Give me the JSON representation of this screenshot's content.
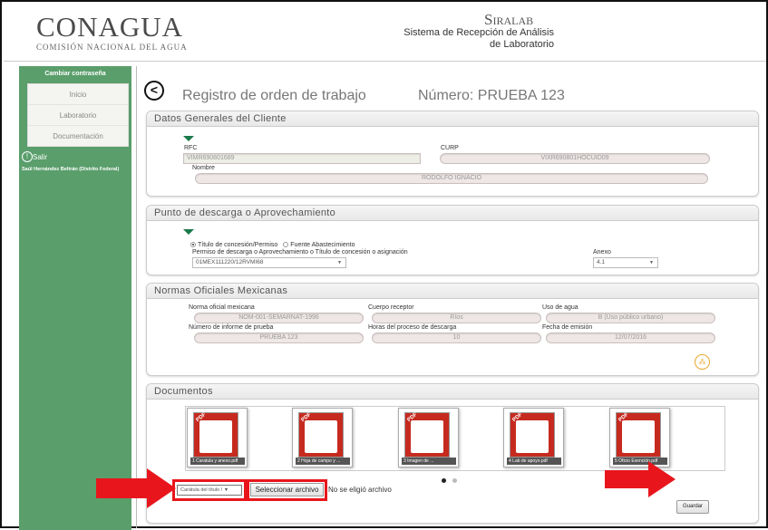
{
  "header": {
    "logo_title": "CONAGUA",
    "logo_subtitle": "COMISIÓN NACIONAL DEL AGUA",
    "system_name": "Siralab",
    "system_line1": "Sistema de Recepción de Análisis",
    "system_line2": "de Laboratorio"
  },
  "sidebar": {
    "change_password": "Cambiar contraseña",
    "items": [
      {
        "label": "Inicio"
      },
      {
        "label": "Laboratorio"
      },
      {
        "label": "Documentación"
      }
    ],
    "exit": "Salir",
    "user": "Saúl Hernández Beltrán (Distrito Federal)"
  },
  "main": {
    "title": "Registro de orden de trabajo",
    "number": "Número: PRUEBA 123"
  },
  "cliente": {
    "heading": "Datos Generales del Cliente",
    "rfc_label": "RFC",
    "rfc_value": "VIMR690801689",
    "curp_label": "CURP",
    "curp_value": "VIXR690801HOCUID09",
    "nombre_label": "Nombre",
    "nombre_value": "RODOLFO IGNACIO"
  },
  "descarga": {
    "heading": "Punto de descarga o Aprovechamiento",
    "radio1": "Título de concesión/Permiso",
    "radio2": "Fuente Abastecimiento",
    "permiso_label": "Permiso de descarga o Aprovechamiento o Título de concesión o asignación",
    "permiso_value": "01MEX111220/12RVMI68",
    "anexo_label": "Anexo",
    "anexo_value": "4.1"
  },
  "normas": {
    "heading": "Normas Oficiales Mexicanas",
    "norma_label": "Norma oficial mexicana",
    "norma_value": "NOM-001-SEMARNAT-1996",
    "cuerpo_label": "Cuerpo receptor",
    "cuerpo_value": "Ríos",
    "uso_label": "Uso de agua",
    "uso_value": "B (Uso público urbano)",
    "informe_label": "Número de informe de prueba",
    "informe_value": "PRUEBA 123",
    "horas_label": "Horas del proceso de descarga",
    "horas_value": "10",
    "fecha_label": "Fecha de emisión",
    "fecha_value": "12/07/2016"
  },
  "documentos": {
    "heading": "Documentos",
    "files": [
      {
        "caption": "1 Caratula y anexo.pdf"
      },
      {
        "caption": "2 Hoja de campo y ..."
      },
      {
        "caption": "3 Imagen de ..."
      },
      {
        "caption": "4 Lab de apoyo.pdf"
      },
      {
        "caption": "5 Oficio Exención.pdf"
      }
    ],
    "select_value": "Carátula del título / ▼",
    "choose_button": "Seleccionar archivo",
    "no_file": "No se eligió archivo",
    "save_button": "Guardar"
  },
  "colors": {
    "sidebar_green": "#5a9e6b",
    "highlight_red": "#e8161c",
    "pdf_red": "#c62a1f"
  }
}
